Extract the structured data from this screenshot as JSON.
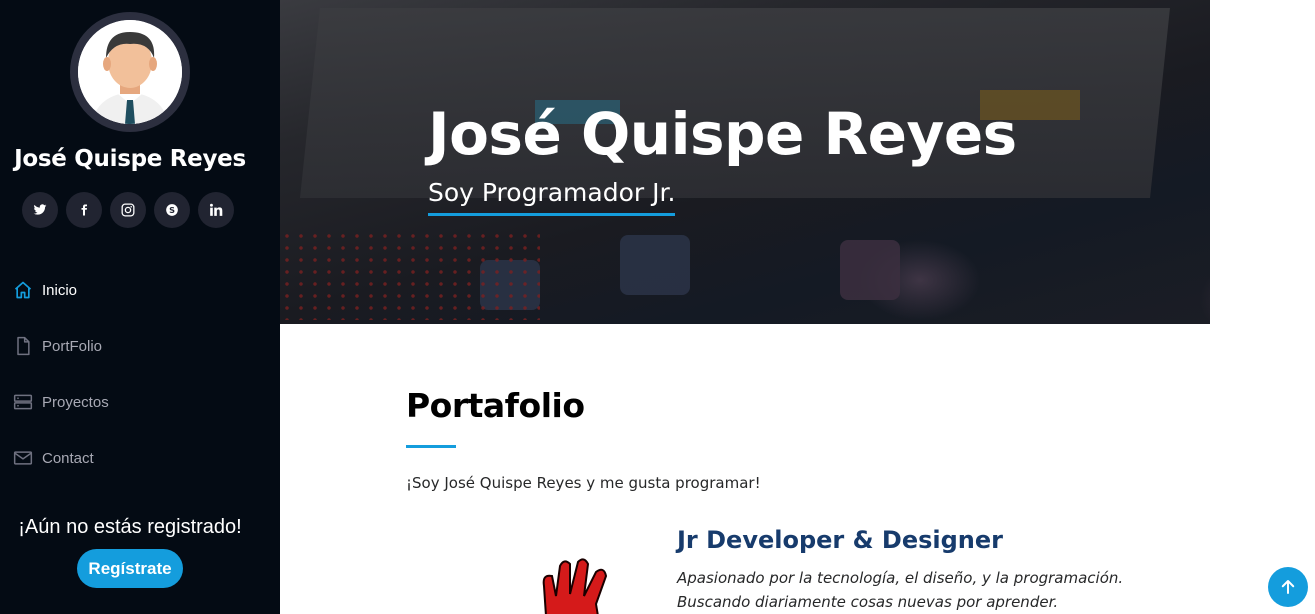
{
  "sidebar": {
    "name": "José Quispe Reyes",
    "social": [
      {
        "icon": "twitter-icon",
        "glyph": "𝕥"
      },
      {
        "icon": "facebook-icon",
        "glyph": "f"
      },
      {
        "icon": "instagram-icon",
        "glyph": "◎"
      },
      {
        "icon": "skype-icon",
        "glyph": "S"
      },
      {
        "icon": "linkedin-icon",
        "glyph": "in"
      }
    ],
    "nav": [
      {
        "label": "Inicio",
        "icon": "home-icon",
        "active": true
      },
      {
        "label": "PortFolio",
        "icon": "file-icon",
        "active": false
      },
      {
        "label": "Proyectos",
        "icon": "server-icon",
        "active": false
      },
      {
        "label": "Contact",
        "icon": "envelope-icon",
        "active": false
      }
    ],
    "register_text": "¡Aún no estás registrado!",
    "register_button": "Regístrate"
  },
  "hero": {
    "title": "José Quispe Reyes",
    "subtitle": "Soy Programador Jr."
  },
  "main": {
    "section_title": "Portafolio",
    "intro": "¡Soy José Quispe Reyes y me gusta programar!",
    "job_title": "Jr Developer & Designer",
    "job_desc": "Apasionado por la tecnología, el diseño, y la programación. Buscando diariamente cosas nuevas por aprender."
  },
  "colors": {
    "accent": "#149ddd",
    "sidebar_bg": "#040b14",
    "heading_blue": "#173b6c"
  }
}
